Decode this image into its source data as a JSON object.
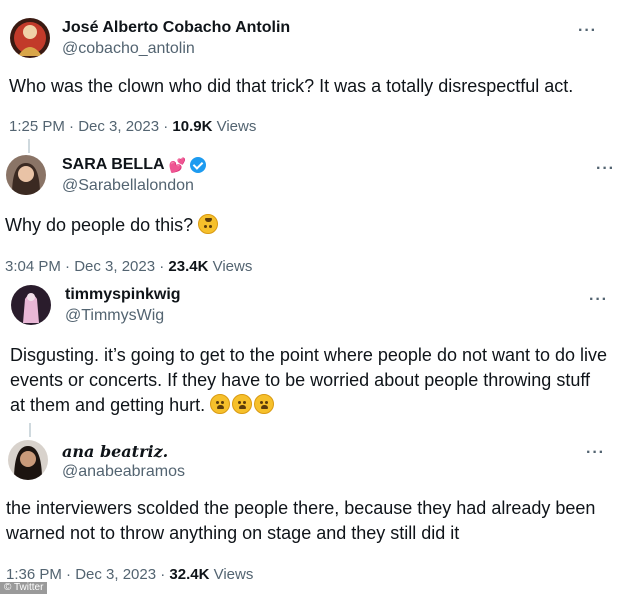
{
  "tweets": [
    {
      "name": "José Alberto Cobacho Antolin",
      "handle": "@cobacho_antolin",
      "text": "Who was the clown who did that trick? It was a totally disrespectful act.",
      "time": "1:25 PM · Dec 3, 2023 · ",
      "views": "10.9K",
      "views_label": " Views",
      "more": "···"
    },
    {
      "name": "SARA BELLA",
      "handle": "@Sarabellalondon",
      "text": "Why do people do this? ",
      "time": "3:04 PM · Dec 3, 2023 · ",
      "views": "23.4K",
      "views_label": " Views",
      "more": "···",
      "name_emoji": "💕",
      "text_emoji": "upside-down-face"
    },
    {
      "name": "timmyspinkwig",
      "handle": "@TimmysWig",
      "text": "Disgusting. it’s going to get to the point where people do not want to do live events or concerts. If they have to be worried about people throwing stuff at them and getting hurt. ",
      "more": "···",
      "text_emoji": "weary-face x3"
    },
    {
      "name": "ana beatriz.",
      "handle": "@anabeabramos",
      "text": "the interviewers scolded the people there, because they had already been warned not to throw anything on stage and they still did it",
      "time": "1:36 PM · Dec 3, 2023 · ",
      "views": "32.4K",
      "views_label": " Views",
      "more": "···"
    }
  ],
  "watermark": "© Twitter",
  "colors": {
    "verified": "#1d9bf0",
    "secondary_text": "#536471",
    "primary_text": "#0f1419"
  }
}
